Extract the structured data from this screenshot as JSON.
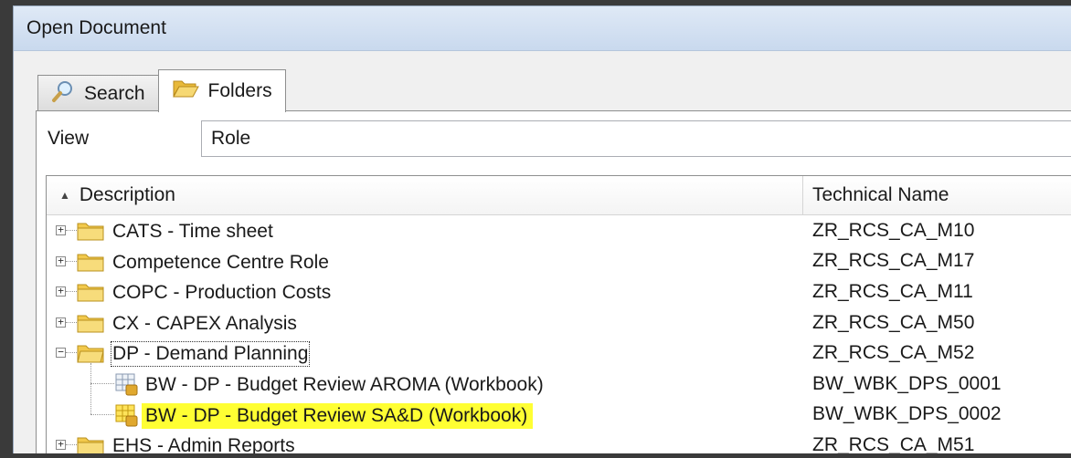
{
  "window": {
    "title": "Open Document"
  },
  "tabs": [
    {
      "label": "Search",
      "icon": "magnifier-icon",
      "active": false
    },
    {
      "label": "Folders",
      "icon": "open-folder-icon",
      "active": true
    }
  ],
  "view": {
    "label": "View",
    "value": "Role"
  },
  "columns": {
    "description": "Description",
    "technical_name": "Technical Name",
    "sort": "ascending"
  },
  "rows": [
    {
      "description": "CATS - Time sheet",
      "technical_name": "ZR_RCS_CA_M10",
      "type": "folder",
      "expanded": false
    },
    {
      "description": "Competence Centre Role",
      "technical_name": "ZR_RCS_CA_M17",
      "type": "folder",
      "expanded": false
    },
    {
      "description": "COPC - Production Costs",
      "technical_name": "ZR_RCS_CA_M11",
      "type": "folder",
      "expanded": false
    },
    {
      "description": "CX - CAPEX Analysis",
      "technical_name": "ZR_RCS_CA_M50",
      "type": "folder",
      "expanded": false
    },
    {
      "description": "DP - Demand Planning",
      "technical_name": "ZR_RCS_CA_M52",
      "type": "folder",
      "expanded": true,
      "focused": true
    },
    {
      "description": "BW - DP - Budget Review AROMA (Workbook)",
      "technical_name": "BW_WBK_DPS_0001",
      "type": "workbook",
      "child": true
    },
    {
      "description": "BW - DP - Budget Review SA&D (Workbook)",
      "technical_name": "BW_WBK_DPS_0002",
      "type": "workbook",
      "child": true,
      "highlighted": true
    },
    {
      "description": "EHS - Admin Reports",
      "technical_name": "ZR_RCS_CA_M51",
      "type": "folder",
      "expanded": false
    }
  ],
  "colors": {
    "highlight": "#ffff33",
    "folder": "#f2c94c",
    "titlebar": "#dfe9f6"
  }
}
